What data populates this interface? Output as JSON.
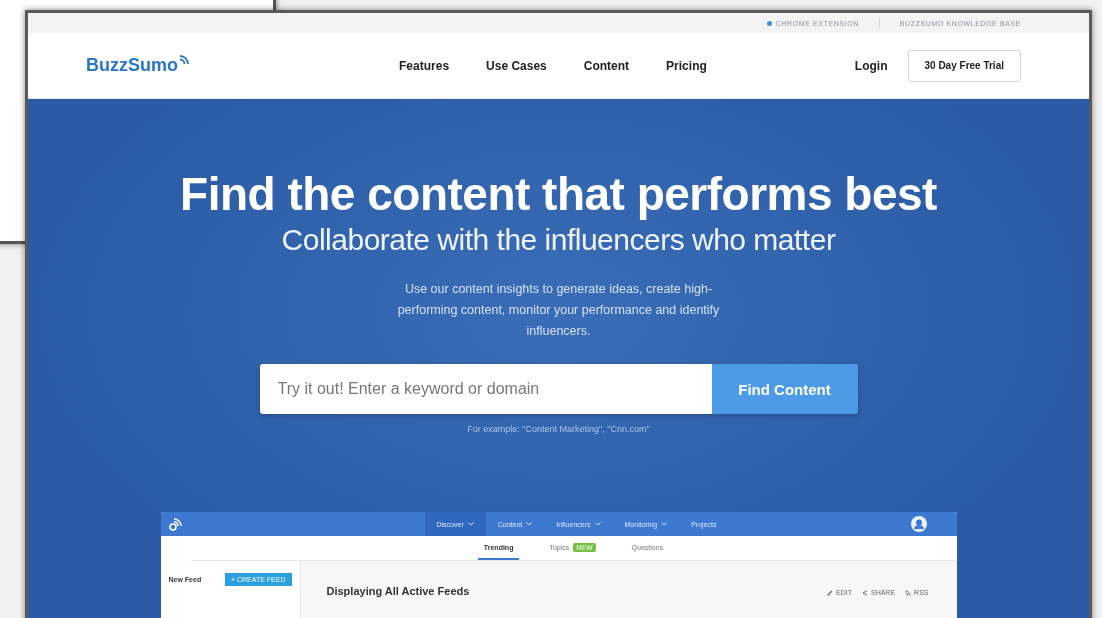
{
  "utility_links": [
    {
      "label": "CHROME EXTENSION",
      "kind": "dot"
    },
    {
      "label": "BUZZSUMO KNOWLEDGE BASE",
      "kind": "plain"
    }
  ],
  "brand": "BuzzSumo",
  "nav": [
    {
      "label": "Features"
    },
    {
      "label": "Use Cases"
    },
    {
      "label": "Content"
    },
    {
      "label": "Pricing"
    }
  ],
  "login": "Login",
  "trial_button": "30 Day Free Trial",
  "hero": {
    "headline": "Find the content that performs best",
    "subheadline": "Collaborate with the influencers who matter",
    "description": "Use our content insights to generate ideas, create high-performing content, monitor your performance and identify influencers.",
    "search": {
      "placeholder": "Try it out! Enter a keyword or domain",
      "button": "Find Content"
    },
    "example": "For example: \"Content Marketing\", \"Cnn.com\""
  },
  "app_preview": {
    "nav": [
      {
        "label": "Discover",
        "selected": true,
        "dropdown": true
      },
      {
        "label": "Content",
        "selected": false,
        "dropdown": true
      },
      {
        "label": "Influencers",
        "selected": false,
        "dropdown": true
      },
      {
        "label": "Monitoring",
        "selected": false,
        "dropdown": true
      },
      {
        "label": "Projects",
        "selected": false,
        "dropdown": false
      }
    ],
    "subtabs": [
      {
        "label": "Trending",
        "selected": true
      },
      {
        "label": "Topics",
        "selected": false,
        "badge": "NEW"
      },
      {
        "label": "Questions",
        "selected": false
      }
    ],
    "sidebar": {
      "title": "New Feed",
      "button": "+ CREATE FEED"
    },
    "heading": "Displaying All Active Feeds",
    "actions": [
      {
        "label": "EDIT",
        "kind": "edit"
      },
      {
        "label": "SHARE",
        "kind": "share"
      },
      {
        "label": "RSS",
        "kind": "rss"
      }
    ]
  }
}
